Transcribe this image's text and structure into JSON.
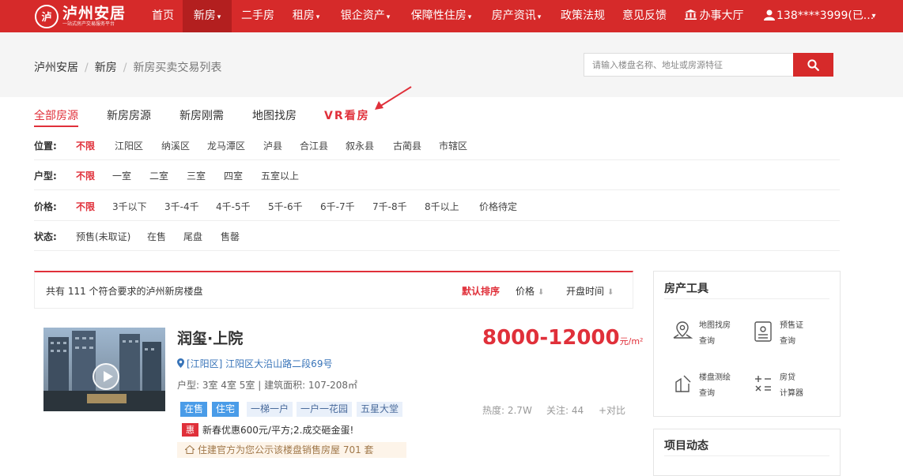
{
  "brand": {
    "logo_mark": "泸",
    "name": "泸州安居",
    "tagline": "一站式房产交易服务平台"
  },
  "nav": {
    "items": [
      {
        "label": "首页",
        "has_dropdown": false
      },
      {
        "label": "新房",
        "has_dropdown": true,
        "active": true
      },
      {
        "label": "二手房",
        "has_dropdown": false
      },
      {
        "label": "租房",
        "has_dropdown": true
      },
      {
        "label": "银企资产",
        "has_dropdown": true
      },
      {
        "label": "保障性住房",
        "has_dropdown": true
      },
      {
        "label": "房产资讯",
        "has_dropdown": true
      },
      {
        "label": "政策法规",
        "has_dropdown": false
      },
      {
        "label": "意见反馈",
        "has_dropdown": false
      }
    ],
    "service_hall": "办事大厅",
    "user": "138****3999(已...",
    "caret": "▾"
  },
  "breadcrumb": {
    "home": "泸州安居",
    "section": "新房",
    "current": "新房买卖交易列表",
    "sep": "/"
  },
  "search": {
    "placeholder": "请输入楼盘名称、地址或房源特征"
  },
  "tabs": [
    {
      "label": "全部房源",
      "active": true
    },
    {
      "label": "新房房源"
    },
    {
      "label": "新房刚需"
    },
    {
      "label": "地图找房"
    },
    {
      "label": "VR看房",
      "highlight": true
    }
  ],
  "filters": {
    "location": {
      "label": "位置:",
      "options": [
        "不限",
        "江阳区",
        "纳溪区",
        "龙马潭区",
        "泸县",
        "合江县",
        "叙永县",
        "古蔺县",
        "市辖区"
      ],
      "selected": "不限"
    },
    "layout": {
      "label": "户型:",
      "options": [
        "不限",
        "一室",
        "二室",
        "三室",
        "四室",
        "五室以上"
      ],
      "selected": "不限"
    },
    "price": {
      "label": "价格:",
      "options": [
        "不限",
        "3千以下",
        "3千-4千",
        "4千-5千",
        "5千-6千",
        "6千-7千",
        "7千-8千",
        "8千以上",
        "价格待定"
      ],
      "selected": "不限"
    },
    "status": {
      "label": "状态:",
      "options": [
        "预售(未取证)",
        "在售",
        "尾盘",
        "售罄"
      ]
    }
  },
  "results": {
    "count_text": "共有 111 个符合要求的泸州新房楼盘",
    "sort": {
      "default": "默认排序",
      "price": "价格",
      "open_time": "开盘时间",
      "arrow": "⬇"
    }
  },
  "listing": {
    "name": "润玺·上院",
    "price": "8000-12000",
    "unit": "元/m²",
    "address": "[江阳区] 江阳区大沿山路二段69号",
    "specs": "户型: 3室 4室 5室 | 建筑面积: 107-208㎡",
    "tags": [
      {
        "label": "在售",
        "style": "blue"
      },
      {
        "label": "住宅",
        "style": "blue"
      },
      {
        "label": "一梯一户",
        "style": "light"
      },
      {
        "label": "一户一花园",
        "style": "light"
      },
      {
        "label": "五星大堂",
        "style": "light"
      }
    ],
    "heat": "热度: 2.7W",
    "follow": "关注: 44",
    "compare": "+对比",
    "promo_badge": "惠",
    "promo_text": "新春优惠600元/平方;2.成交砸金蛋!",
    "notice": "住建官方为您公示该楼盘销售房屋 701 套"
  },
  "tools": {
    "title": "房产工具",
    "items": [
      {
        "line1": "地图找房",
        "line2": "查询",
        "icon": "map-pin-icon"
      },
      {
        "line1": "预售证",
        "line2": "查询",
        "icon": "certificate-icon"
      },
      {
        "line1": "楼盘测绘",
        "line2": "查询",
        "icon": "survey-icon"
      },
      {
        "line1": "房贷",
        "line2": "计算器",
        "icon": "calculator-icon"
      }
    ]
  },
  "news": {
    "title": "项目动态"
  },
  "colors": {
    "brand_red": "#d62a2a",
    "accent_red": "#e0303a",
    "tag_blue": "#4a9ce8",
    "link_blue": "#3773b8"
  }
}
